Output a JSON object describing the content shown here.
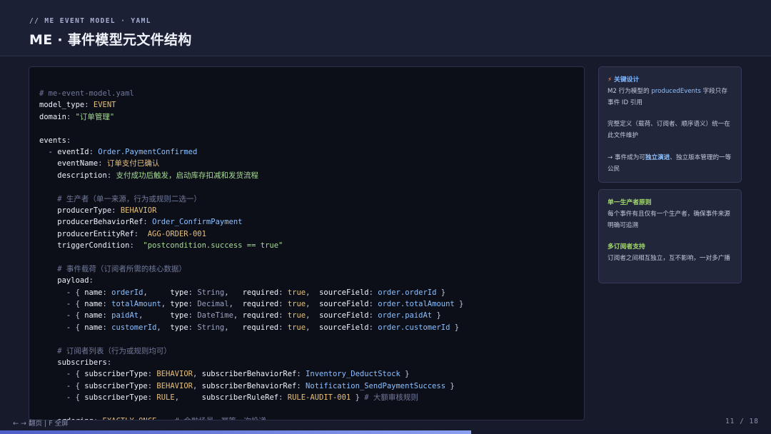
{
  "header": {
    "eyebrow": "// ME EVENT MODEL · YAML",
    "title": "ME · 事件模型元文件结构"
  },
  "code": {
    "lines": [
      [
        {
          "t": "# me-event-model.yaml",
          "c": "c"
        }
      ],
      [
        {
          "t": "model_type",
          "c": "k"
        },
        {
          "t": ": ",
          "c": "p"
        },
        {
          "t": "EVENT",
          "c": "v"
        }
      ],
      [
        {
          "t": "domain",
          "c": "k"
        },
        {
          "t": ": ",
          "c": "p"
        },
        {
          "t": "\"订单管理\"",
          "c": "s"
        }
      ],
      [],
      [
        {
          "t": "events",
          "c": "k"
        },
        {
          "t": ":",
          "c": "p"
        }
      ],
      [
        {
          "t": "  - ",
          "c": "p"
        },
        {
          "t": "eventId",
          "c": "k"
        },
        {
          "t": ": ",
          "c": "p"
        },
        {
          "t": "Order.PaymentConfirmed",
          "c": "b"
        }
      ],
      [
        {
          "t": "    eventName",
          "c": "k"
        },
        {
          "t": ": ",
          "c": "p"
        },
        {
          "t": "订单支付已确认",
          "c": "v"
        }
      ],
      [
        {
          "t": "    description",
          "c": "k"
        },
        {
          "t": ": ",
          "c": "p"
        },
        {
          "t": "支付成功后触发，启动库存扣减和发货流程",
          "c": "s"
        }
      ],
      [],
      [
        {
          "t": "    # 生产者（单一来源，行为或规则二选一）",
          "c": "c"
        }
      ],
      [
        {
          "t": "    producerType",
          "c": "k"
        },
        {
          "t": ": ",
          "c": "p"
        },
        {
          "t": "BEHAVIOR",
          "c": "v"
        }
      ],
      [
        {
          "t": "    producerBehaviorRef",
          "c": "k"
        },
        {
          "t": ": ",
          "c": "p"
        },
        {
          "t": "Order_ConfirmPayment",
          "c": "b"
        }
      ],
      [
        {
          "t": "    producerEntityRef",
          "c": "k"
        },
        {
          "t": ":  ",
          "c": "p"
        },
        {
          "t": "AGG-ORDER-001",
          "c": "v"
        }
      ],
      [
        {
          "t": "    triggerCondition",
          "c": "k"
        },
        {
          "t": ":  ",
          "c": "p"
        },
        {
          "t": "\"postcondition.success == true\"",
          "c": "s"
        }
      ],
      [],
      [
        {
          "t": "    # 事件载荷（订阅者所需的核心数据）",
          "c": "c"
        }
      ],
      [
        {
          "t": "    payload",
          "c": "k"
        },
        {
          "t": ":",
          "c": "p"
        }
      ],
      [
        {
          "t": "      - { ",
          "c": "p"
        },
        {
          "t": "name",
          "c": "k"
        },
        {
          "t": ": ",
          "c": "p"
        },
        {
          "t": "orderId",
          "c": "b"
        },
        {
          "t": ",     ",
          "c": "p"
        },
        {
          "t": "type",
          "c": "k"
        },
        {
          "t": ": ",
          "c": "p"
        },
        {
          "t": "String",
          "c": "d"
        },
        {
          "t": ",   ",
          "c": "p"
        },
        {
          "t": "required",
          "c": "k"
        },
        {
          "t": ": ",
          "c": "p"
        },
        {
          "t": "true",
          "c": "v"
        },
        {
          "t": ",  ",
          "c": "p"
        },
        {
          "t": "sourceField",
          "c": "k"
        },
        {
          "t": ": ",
          "c": "p"
        },
        {
          "t": "order.orderId",
          "c": "b"
        },
        {
          "t": " }",
          "c": "p"
        }
      ],
      [
        {
          "t": "      - { ",
          "c": "p"
        },
        {
          "t": "name",
          "c": "k"
        },
        {
          "t": ": ",
          "c": "p"
        },
        {
          "t": "totalAmount",
          "c": "b"
        },
        {
          "t": ", ",
          "c": "p"
        },
        {
          "t": "type",
          "c": "k"
        },
        {
          "t": ": ",
          "c": "p"
        },
        {
          "t": "Decimal",
          "c": "d"
        },
        {
          "t": ",  ",
          "c": "p"
        },
        {
          "t": "required",
          "c": "k"
        },
        {
          "t": ": ",
          "c": "p"
        },
        {
          "t": "true",
          "c": "v"
        },
        {
          "t": ",  ",
          "c": "p"
        },
        {
          "t": "sourceField",
          "c": "k"
        },
        {
          "t": ": ",
          "c": "p"
        },
        {
          "t": "order.totalAmount",
          "c": "b"
        },
        {
          "t": " }",
          "c": "p"
        }
      ],
      [
        {
          "t": "      - { ",
          "c": "p"
        },
        {
          "t": "name",
          "c": "k"
        },
        {
          "t": ": ",
          "c": "p"
        },
        {
          "t": "paidAt",
          "c": "b"
        },
        {
          "t": ",      ",
          "c": "p"
        },
        {
          "t": "type",
          "c": "k"
        },
        {
          "t": ": ",
          "c": "p"
        },
        {
          "t": "DateTime",
          "c": "d"
        },
        {
          "t": ", ",
          "c": "p"
        },
        {
          "t": "required",
          "c": "k"
        },
        {
          "t": ": ",
          "c": "p"
        },
        {
          "t": "true",
          "c": "v"
        },
        {
          "t": ",  ",
          "c": "p"
        },
        {
          "t": "sourceField",
          "c": "k"
        },
        {
          "t": ": ",
          "c": "p"
        },
        {
          "t": "order.paidAt",
          "c": "b"
        },
        {
          "t": " }",
          "c": "p"
        }
      ],
      [
        {
          "t": "      - { ",
          "c": "p"
        },
        {
          "t": "name",
          "c": "k"
        },
        {
          "t": ": ",
          "c": "p"
        },
        {
          "t": "customerId",
          "c": "b"
        },
        {
          "t": ",  ",
          "c": "p"
        },
        {
          "t": "type",
          "c": "k"
        },
        {
          "t": ": ",
          "c": "p"
        },
        {
          "t": "String",
          "c": "d"
        },
        {
          "t": ",   ",
          "c": "p"
        },
        {
          "t": "required",
          "c": "k"
        },
        {
          "t": ": ",
          "c": "p"
        },
        {
          "t": "true",
          "c": "v"
        },
        {
          "t": ",  ",
          "c": "p"
        },
        {
          "t": "sourceField",
          "c": "k"
        },
        {
          "t": ": ",
          "c": "p"
        },
        {
          "t": "order.customerId",
          "c": "b"
        },
        {
          "t": " }",
          "c": "p"
        }
      ],
      [],
      [
        {
          "t": "    # 订阅者列表（行为或规则均可）",
          "c": "c"
        }
      ],
      [
        {
          "t": "    subscribers",
          "c": "k"
        },
        {
          "t": ":",
          "c": "p"
        }
      ],
      [
        {
          "t": "      - { ",
          "c": "p"
        },
        {
          "t": "subscriberType",
          "c": "k"
        },
        {
          "t": ": ",
          "c": "p"
        },
        {
          "t": "BEHAVIOR",
          "c": "v"
        },
        {
          "t": ", ",
          "c": "p"
        },
        {
          "t": "subscriberBehaviorRef",
          "c": "k"
        },
        {
          "t": ": ",
          "c": "p"
        },
        {
          "t": "Inventory_DeductStock",
          "c": "b"
        },
        {
          "t": " }",
          "c": "p"
        }
      ],
      [
        {
          "t": "      - { ",
          "c": "p"
        },
        {
          "t": "subscriberType",
          "c": "k"
        },
        {
          "t": ": ",
          "c": "p"
        },
        {
          "t": "BEHAVIOR",
          "c": "v"
        },
        {
          "t": ", ",
          "c": "p"
        },
        {
          "t": "subscriberBehaviorRef",
          "c": "k"
        },
        {
          "t": ": ",
          "c": "p"
        },
        {
          "t": "Notification_SendPaymentSuccess",
          "c": "b"
        },
        {
          "t": " }",
          "c": "p"
        }
      ],
      [
        {
          "t": "      - { ",
          "c": "p"
        },
        {
          "t": "subscriberType",
          "c": "k"
        },
        {
          "t": ": ",
          "c": "p"
        },
        {
          "t": "RULE",
          "c": "v"
        },
        {
          "t": ",     ",
          "c": "p"
        },
        {
          "t": "subscriberRuleRef",
          "c": "k"
        },
        {
          "t": ": ",
          "c": "p"
        },
        {
          "t": "RULE-AUDIT-001",
          "c": "v"
        },
        {
          "t": " } ",
          "c": "p"
        },
        {
          "t": "# 大额审核规则",
          "c": "c"
        }
      ],
      [],
      [
        {
          "t": "    ordering",
          "c": "k"
        },
        {
          "t": ": ",
          "c": "p"
        },
        {
          "t": "EXACTLY_ONCE",
          "c": "v"
        },
        {
          "t": "    ",
          "c": "p"
        },
        {
          "t": "# 金融场景，幂等一次投递",
          "c": "c"
        }
      ]
    ]
  },
  "cards": {
    "card1": {
      "icon": "lightning-icon",
      "title": "关键设计",
      "p1_pre": "M2 行为模型的 ",
      "p1_hl": "producedEvents",
      "p1_post": " 字段只存事件 ID 引用",
      "p2": "完整定义（载荷、订阅者、顺序语义）统一在此文件维护",
      "p3_pre": "→ 事件成为可",
      "p3_hl": "独立演进",
      "p3_post": "、独立版本管理的一等公民"
    },
    "card2": {
      "title1": "单一生产者原则",
      "body1": "每个事件有且仅有一个生产者，确保事件来源明确可追溯",
      "title2": "多订阅者支持",
      "body2": "订阅者之间相互独立，互不影响，一对多广播"
    }
  },
  "footer": {
    "nav": "← → 翻页 | F 全屏",
    "page": "11 / 18",
    "progress": 0.611
  },
  "colors": {
    "background": "#171a2b",
    "accent": "#7fb8ff",
    "green": "#a5d96f",
    "code_bg": "#0c0e18"
  }
}
